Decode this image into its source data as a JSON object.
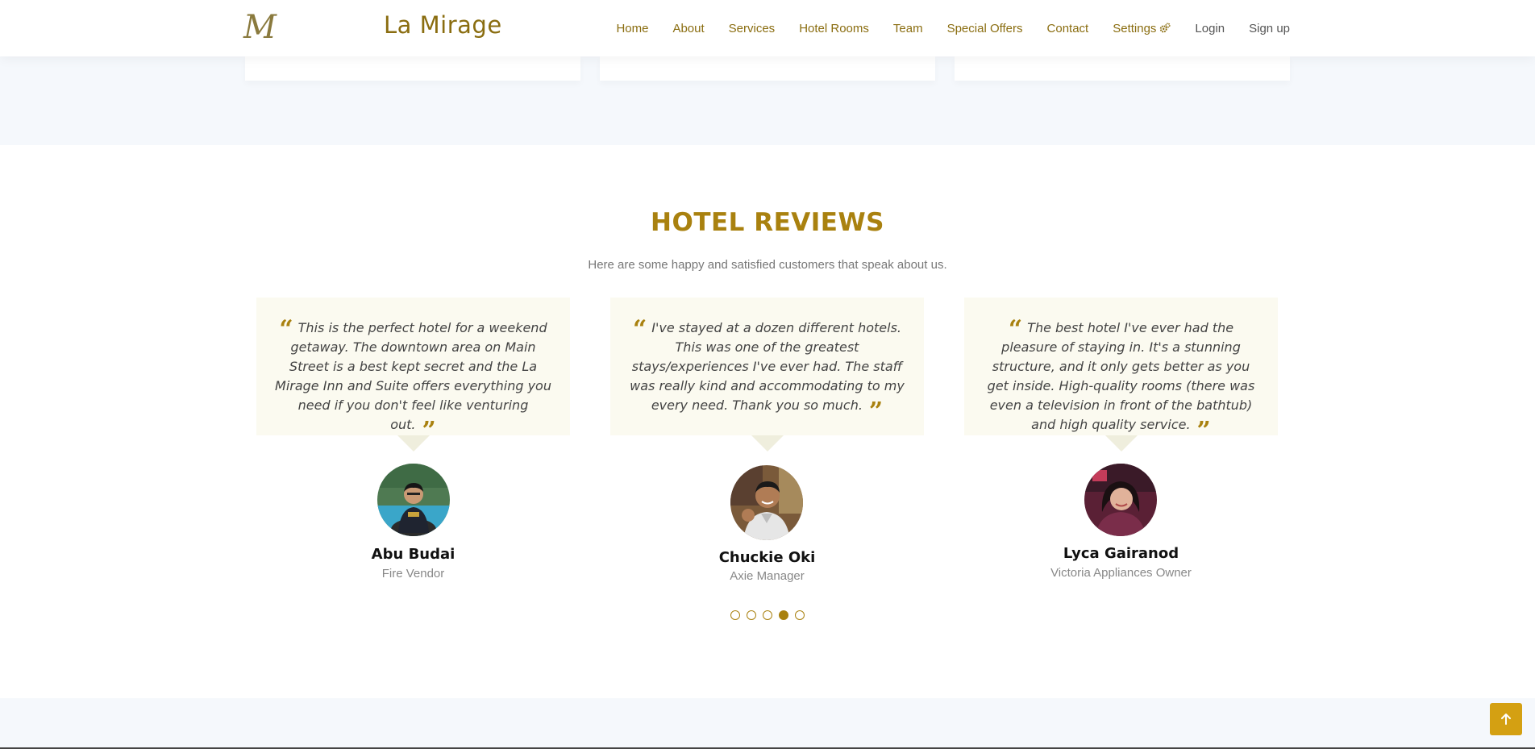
{
  "header": {
    "brand": "La Mirage",
    "logo_letter": "M",
    "nav": [
      {
        "label": "Home"
      },
      {
        "label": "About"
      },
      {
        "label": "Services"
      },
      {
        "label": "Hotel Rooms"
      },
      {
        "label": "Team"
      },
      {
        "label": "Special Offers"
      },
      {
        "label": "Contact"
      },
      {
        "label": "Settings"
      },
      {
        "label": "Login"
      },
      {
        "label": "Sign up"
      }
    ]
  },
  "reviews": {
    "title": "HOTEL REVIEWS",
    "subtitle": "Here are some happy and satisfied customers that speak about us.",
    "items": [
      {
        "text": "This is the perfect hotel for a weekend getaway. The downtown area on Main Street is a best kept secret and the La Mirage Inn and Suite offers everything you need if you don't feel like venturing out.",
        "name": "Abu Budai",
        "role": "Fire Vendor",
        "avatar_icon": "person-photo"
      },
      {
        "text": "I've stayed at a dozen different hotels. This was one of the greatest stays/experiences I've ever had. The staff was really kind and accommodating to my every need. Thank you so much.",
        "name": "Chuckie Oki",
        "role": "Axie Manager",
        "avatar_icon": "person-photo"
      },
      {
        "text": "The best hotel I've ever had the pleasure of staying in. It's a stunning structure, and it only gets better as you get inside. High-quality rooms (there was even a television in front of the bathtub) and high quality service.",
        "name": "Lyca Gairanod",
        "role": "Victoria Appliances Owner",
        "avatar_icon": "person-photo"
      }
    ],
    "pagination": {
      "count": 5,
      "active_index": 3
    }
  },
  "colors": {
    "accent": "#a9810f",
    "brand": "#8a6d10",
    "bubble": "#fbfaf0",
    "strip": "#f5f8fc",
    "back_to_top": "#d4a012"
  },
  "icons": {
    "settings": "gears-icon",
    "back_to_top": "arrow-up-icon"
  }
}
